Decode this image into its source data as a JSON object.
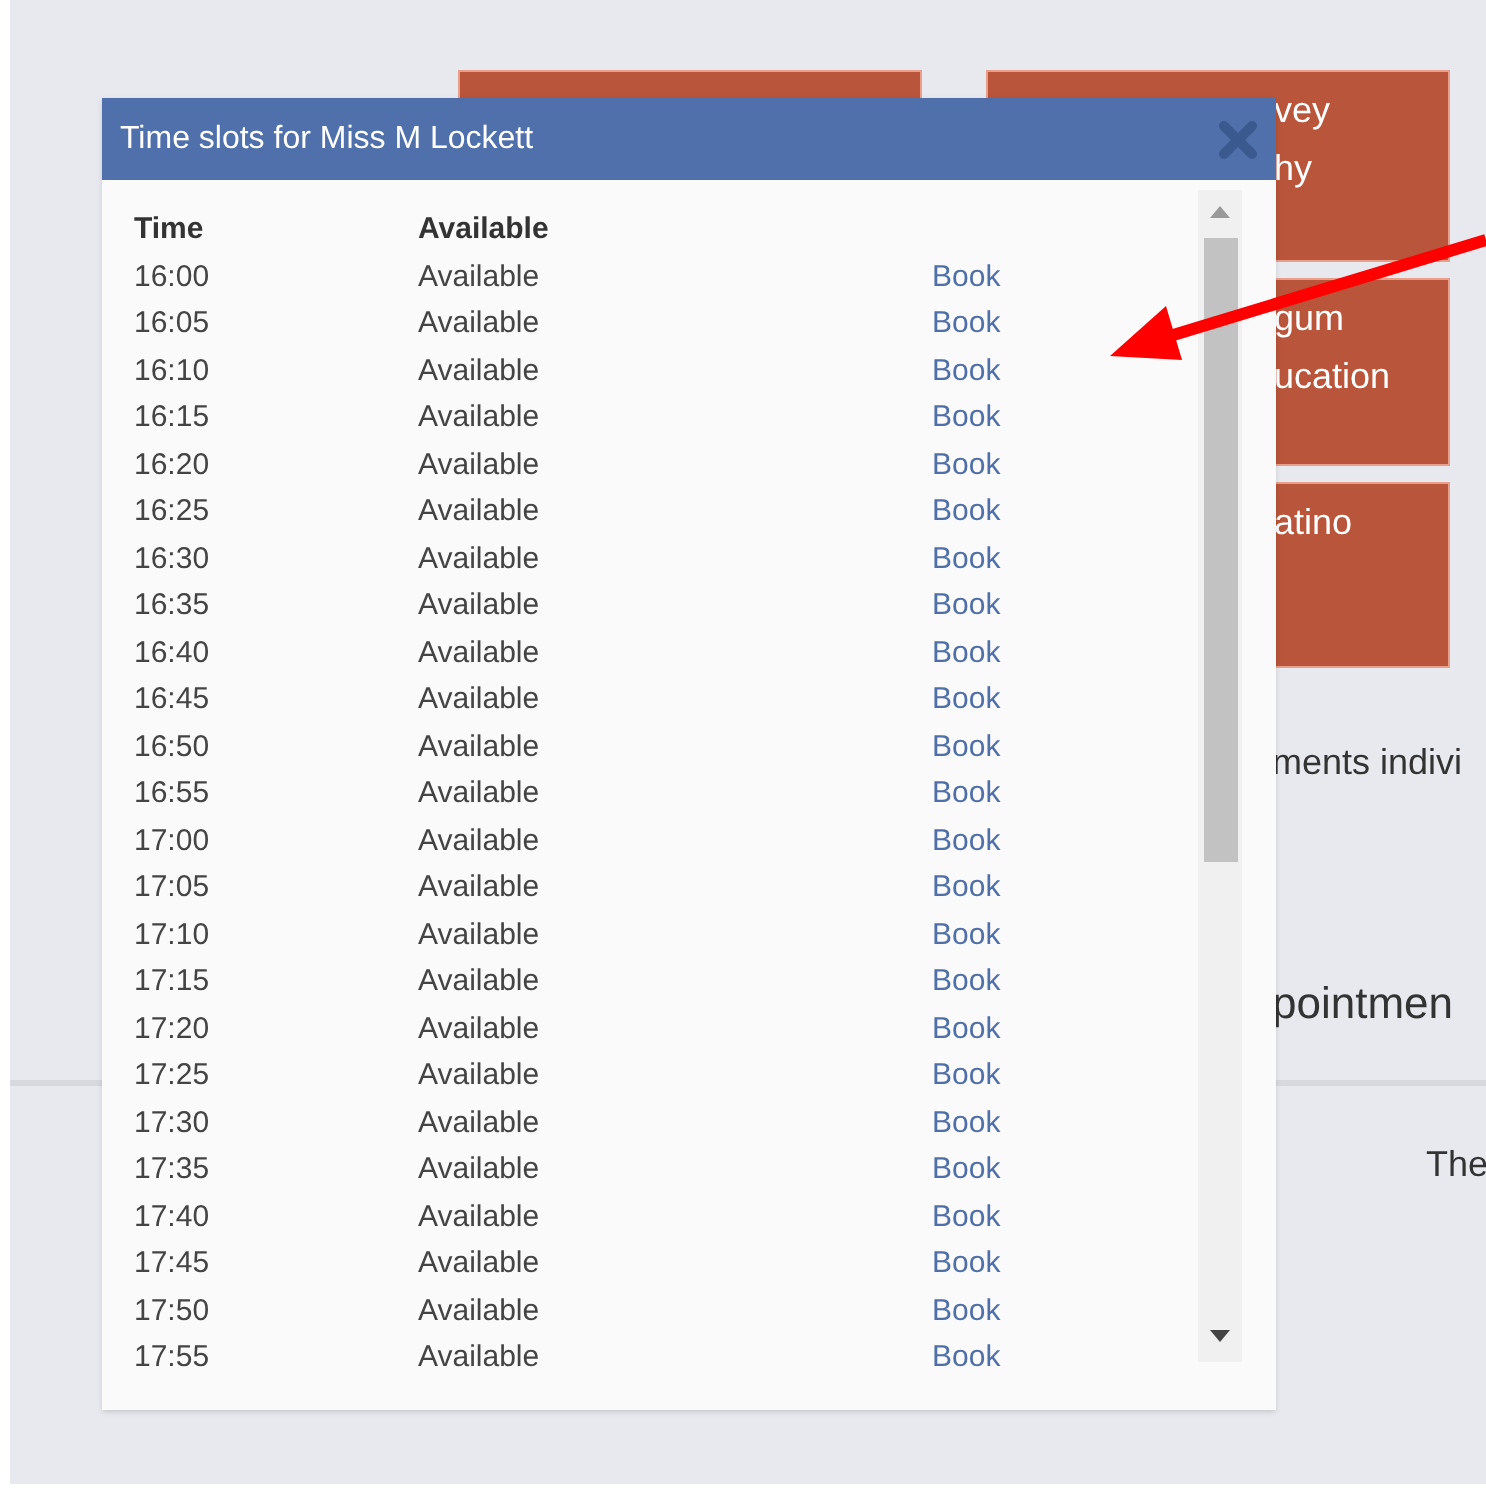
{
  "background": {
    "tiles": [
      {
        "kind": "blank"
      },
      {
        "lines": [
          "vey",
          "hy"
        ]
      },
      {
        "lines": [
          "gum",
          "ucation"
        ]
      },
      {
        "lines": [
          "atino"
        ]
      }
    ],
    "texts": [
      {
        "kind": "body",
        "text": "ments indivi"
      },
      {
        "kind": "heading",
        "text": "pointmen"
      },
      {
        "kind": "body",
        "text": "The"
      }
    ]
  },
  "dialog": {
    "title": "Time slots for Miss M Lockett",
    "columns": [
      "Time",
      "Available"
    ],
    "rows": [
      {
        "time": "16:00",
        "status": "Available",
        "action": "Book"
      },
      {
        "time": "16:05",
        "status": "Available",
        "action": "Book"
      },
      {
        "time": "16:10",
        "status": "Available",
        "action": "Book"
      },
      {
        "time": "16:15",
        "status": "Available",
        "action": "Book"
      },
      {
        "time": "16:20",
        "status": "Available",
        "action": "Book"
      },
      {
        "time": "16:25",
        "status": "Available",
        "action": "Book"
      },
      {
        "time": "16:30",
        "status": "Available",
        "action": "Book"
      },
      {
        "time": "16:35",
        "status": "Available",
        "action": "Book"
      },
      {
        "time": "16:40",
        "status": "Available",
        "action": "Book"
      },
      {
        "time": "16:45",
        "status": "Available",
        "action": "Book"
      },
      {
        "time": "16:50",
        "status": "Available",
        "action": "Book"
      },
      {
        "time": "16:55",
        "status": "Available",
        "action": "Book"
      },
      {
        "time": "17:00",
        "status": "Available",
        "action": "Book"
      },
      {
        "time": "17:05",
        "status": "Available",
        "action": "Book"
      },
      {
        "time": "17:10",
        "status": "Available",
        "action": "Book"
      },
      {
        "time": "17:15",
        "status": "Available",
        "action": "Book"
      },
      {
        "time": "17:20",
        "status": "Available",
        "action": "Book"
      },
      {
        "time": "17:25",
        "status": "Available",
        "action": "Book"
      },
      {
        "time": "17:30",
        "status": "Available",
        "action": "Book"
      },
      {
        "time": "17:35",
        "status": "Available",
        "action": "Book"
      },
      {
        "time": "17:40",
        "status": "Available",
        "action": "Book"
      },
      {
        "time": "17:45",
        "status": "Available",
        "action": "Book"
      },
      {
        "time": "17:50",
        "status": "Available",
        "action": "Book"
      },
      {
        "time": "17:55",
        "status": "Available",
        "action": "Book"
      }
    ]
  }
}
